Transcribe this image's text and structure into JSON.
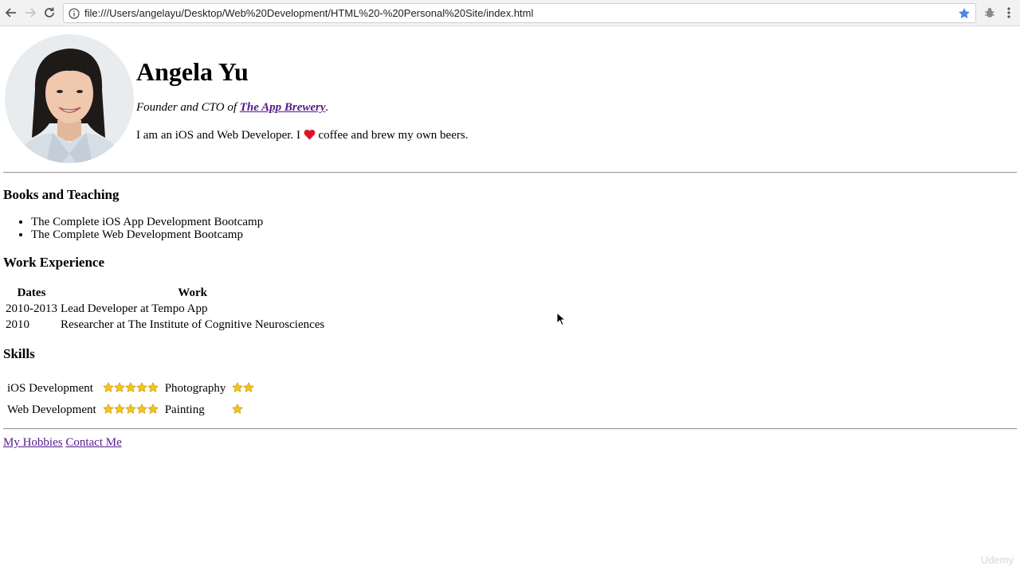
{
  "browser": {
    "url": "file:///Users/angelayu/Desktop/Web%20Development/HTML%20-%20Personal%20Site/index.html",
    "accent": "#4a86e8"
  },
  "header": {
    "name": "Angela Yu",
    "tagline_prefix": "Founder and CTO of ",
    "company_link": "The App Brewery",
    "tagline_suffix": ".",
    "about_prefix": "I am an iOS and Web Developer. I ",
    "about_icon": "heart-icon",
    "about_suffix": " coffee and brew my own beers."
  },
  "books": {
    "title": "Books and Teaching",
    "items": [
      "The Complete iOS App Development Bootcamp",
      "The Complete Web Development Bootcamp"
    ]
  },
  "work": {
    "title": "Work Experience",
    "headers": [
      "Dates",
      "Work"
    ],
    "rows": [
      [
        "2010-2013",
        "Lead Developer at Tempo App"
      ],
      [
        "2010",
        "Researcher at The Institute of Cognitive Neurosciences"
      ]
    ]
  },
  "skills": {
    "title": "Skills",
    "items": [
      {
        "label": "iOS Development",
        "stars": 5
      },
      {
        "label": "Photography",
        "stars": 2
      },
      {
        "label": "Web Development",
        "stars": 5
      },
      {
        "label": "Painting",
        "stars": 1
      }
    ],
    "star_color": "#f5c518"
  },
  "footer": {
    "hobbies_link": "My Hobbies",
    "contact_link": "Contact Me"
  },
  "watermark": "Udemy",
  "link_color": "#551a8b"
}
